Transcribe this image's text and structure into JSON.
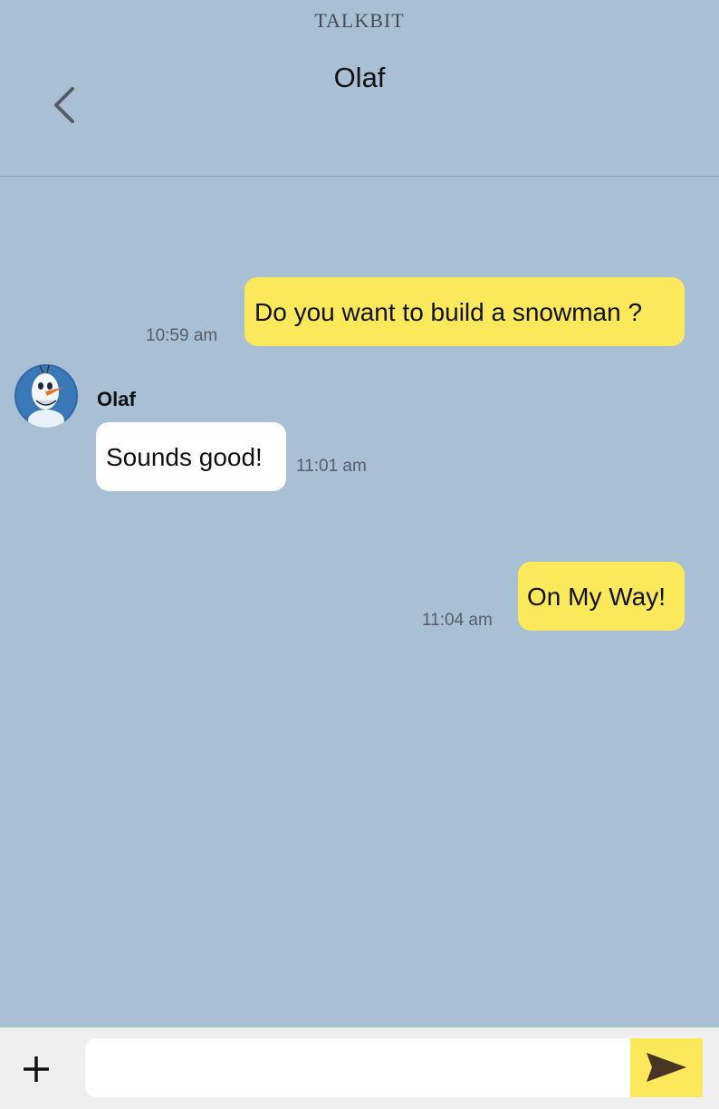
{
  "app": {
    "name": "TALKBIT"
  },
  "header": {
    "title": "Olaf",
    "back_icon": "chevron-left-icon"
  },
  "messages": [
    {
      "sender": "me",
      "text": "Do you want to build a snowman ?",
      "time": "10:59 am"
    },
    {
      "sender": "Olaf",
      "text": "Sounds good!",
      "time": "11:01 am"
    },
    {
      "sender": "me",
      "text": "On My Way!",
      "time": "11:04 am"
    }
  ],
  "composer": {
    "input_value": "",
    "input_placeholder": "",
    "add_icon": "plus-icon",
    "send_icon": "send-icon"
  },
  "colors": {
    "background": "#a8bfd4",
    "my_bubble": "#fbe85b",
    "their_bubble": "#ffffff",
    "send_button": "#fbe85b",
    "composer_bar": "#efefef"
  }
}
